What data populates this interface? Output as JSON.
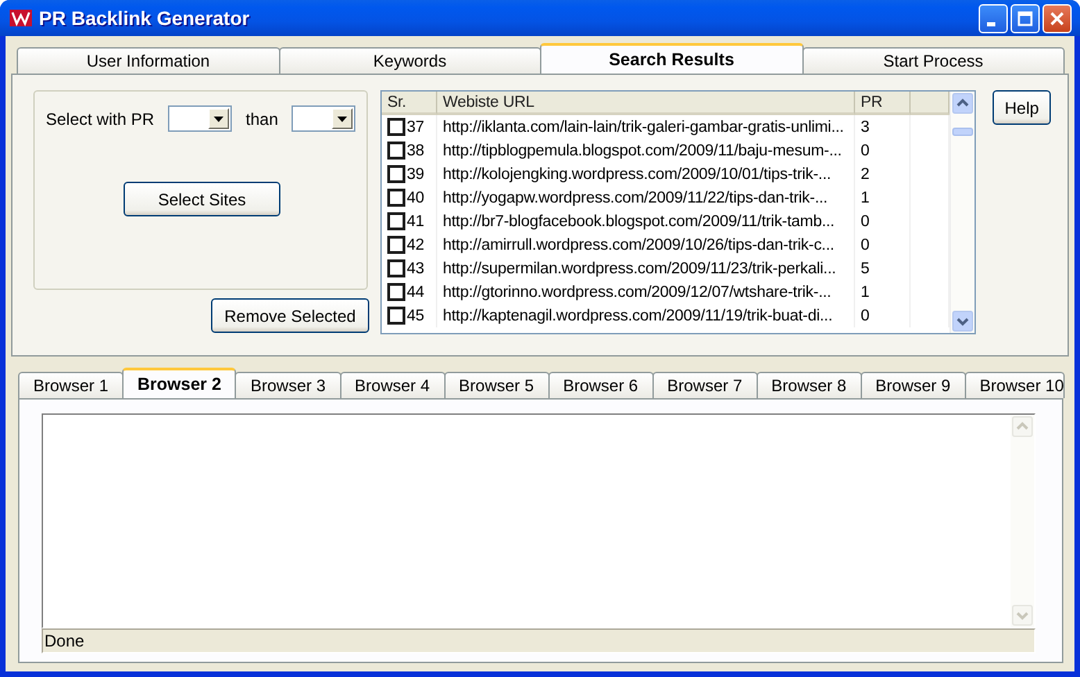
{
  "window": {
    "title": "PR Backlink Generator"
  },
  "tabs": [
    {
      "label": "User Information",
      "selected": false
    },
    {
      "label": "Keywords",
      "selected": false
    },
    {
      "label": "Search Results",
      "selected": true
    },
    {
      "label": "Start Process",
      "selected": false
    }
  ],
  "filter": {
    "label": "Select with PR",
    "between_label": "than",
    "select_button": "Select Sites"
  },
  "remove_button": "Remove Selected",
  "help_button": "Help",
  "table": {
    "columns": [
      "Sr.",
      "Webiste URL",
      "PR"
    ],
    "rows": [
      {
        "checked": false,
        "sr": "37",
        "url": "http://iklanta.com/lain-lain/trik-galeri-gambar-gratis-unlimi...",
        "pr": "3"
      },
      {
        "checked": false,
        "sr": "38",
        "url": "http://tipblogpemula.blogspot.com/2009/11/baju-mesum-...",
        "pr": "0"
      },
      {
        "checked": false,
        "sr": "39",
        "url": "http://kolojengking.wordpress.com/2009/10/01/tips-trik-...",
        "pr": "2"
      },
      {
        "checked": false,
        "sr": "40",
        "url": "http://yogapw.wordpress.com/2009/11/22/tips-dan-trik-...",
        "pr": "1"
      },
      {
        "checked": false,
        "sr": "41",
        "url": "http://br7-blogfacebook.blogspot.com/2009/11/trik-tamb...",
        "pr": "0"
      },
      {
        "checked": false,
        "sr": "42",
        "url": "http://amirrull.wordpress.com/2009/10/26/tips-dan-trik-c...",
        "pr": "0"
      },
      {
        "checked": false,
        "sr": "43",
        "url": "http://supermilan.wordpress.com/2009/11/23/trik-perkali...",
        "pr": "5"
      },
      {
        "checked": false,
        "sr": "44",
        "url": "http://gtorinno.wordpress.com/2009/12/07/wtshare-trik-...",
        "pr": "1"
      },
      {
        "checked": false,
        "sr": "45",
        "url": "http://kaptenagil.wordpress.com/2009/11/19/trik-buat-di...",
        "pr": "0"
      }
    ]
  },
  "browser_tabs": [
    {
      "label": "Browser 1",
      "selected": false
    },
    {
      "label": "Browser 2",
      "selected": true
    },
    {
      "label": "Browser 3",
      "selected": false
    },
    {
      "label": "Browser 4",
      "selected": false
    },
    {
      "label": "Browser 5",
      "selected": false
    },
    {
      "label": "Browser 6",
      "selected": false
    },
    {
      "label": "Browser 7",
      "selected": false
    },
    {
      "label": "Browser 8",
      "selected": false
    },
    {
      "label": "Browser 9",
      "selected": false
    },
    {
      "label": "Browser 10",
      "selected": false
    }
  ],
  "status_bar": "Done"
}
